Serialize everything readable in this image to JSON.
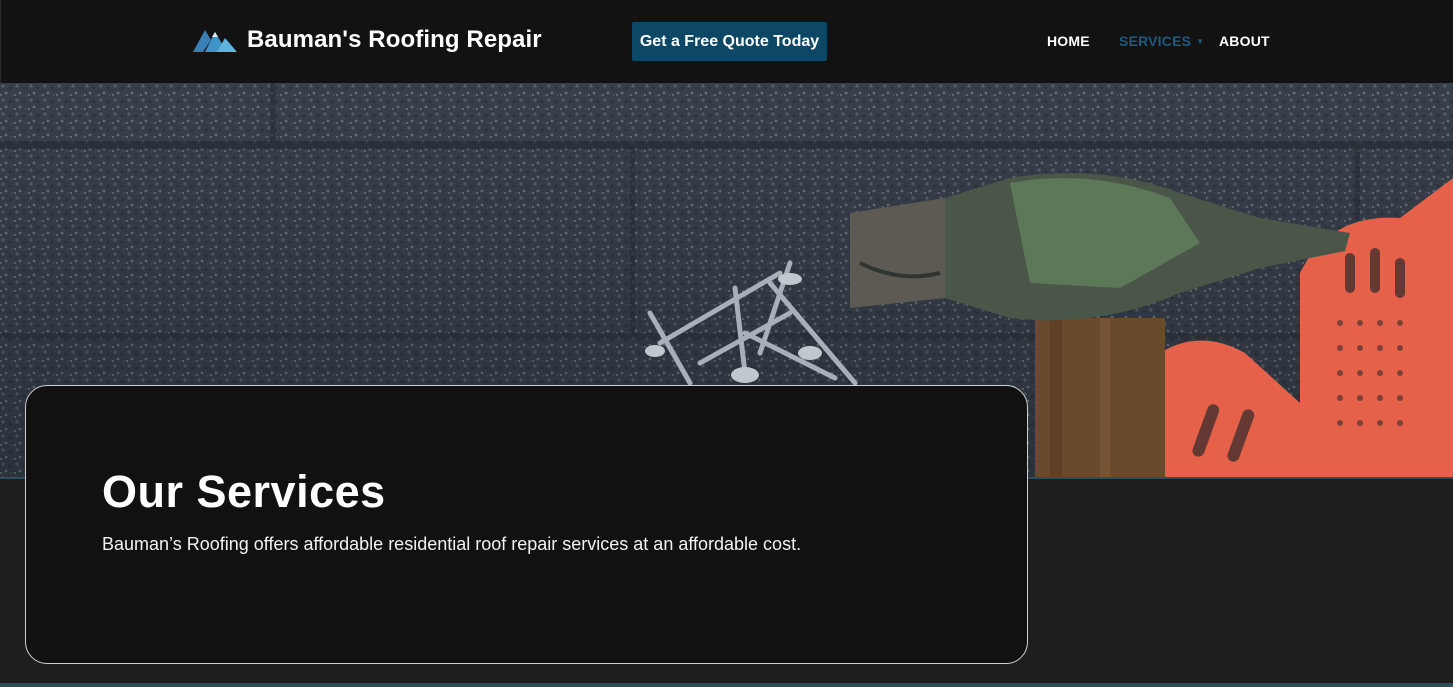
{
  "header": {
    "brand": "Bauman's Roofing Repair",
    "cta_label": "Get a Free Quote Today",
    "nav": [
      {
        "label": "HOME"
      },
      {
        "label": "SERVICES"
      },
      {
        "label": "ABOUT"
      }
    ],
    "logo_icon": "mountain-logo-icon",
    "services_dropdown_icon": "chevron-down-icon"
  },
  "hero": {
    "image": "roof-shingles-with-hammer-nails-and-gloves"
  },
  "card": {
    "title": "Our Services",
    "description": "Bauman’s Roofing offers affordable residential roof repair services at an affordable cost."
  },
  "colors": {
    "header_bg": "#121212",
    "accent": "#0d4766",
    "nav_active": "#1f5a80",
    "card_bg": "#111111",
    "page_bg": "#1e1e1e"
  }
}
